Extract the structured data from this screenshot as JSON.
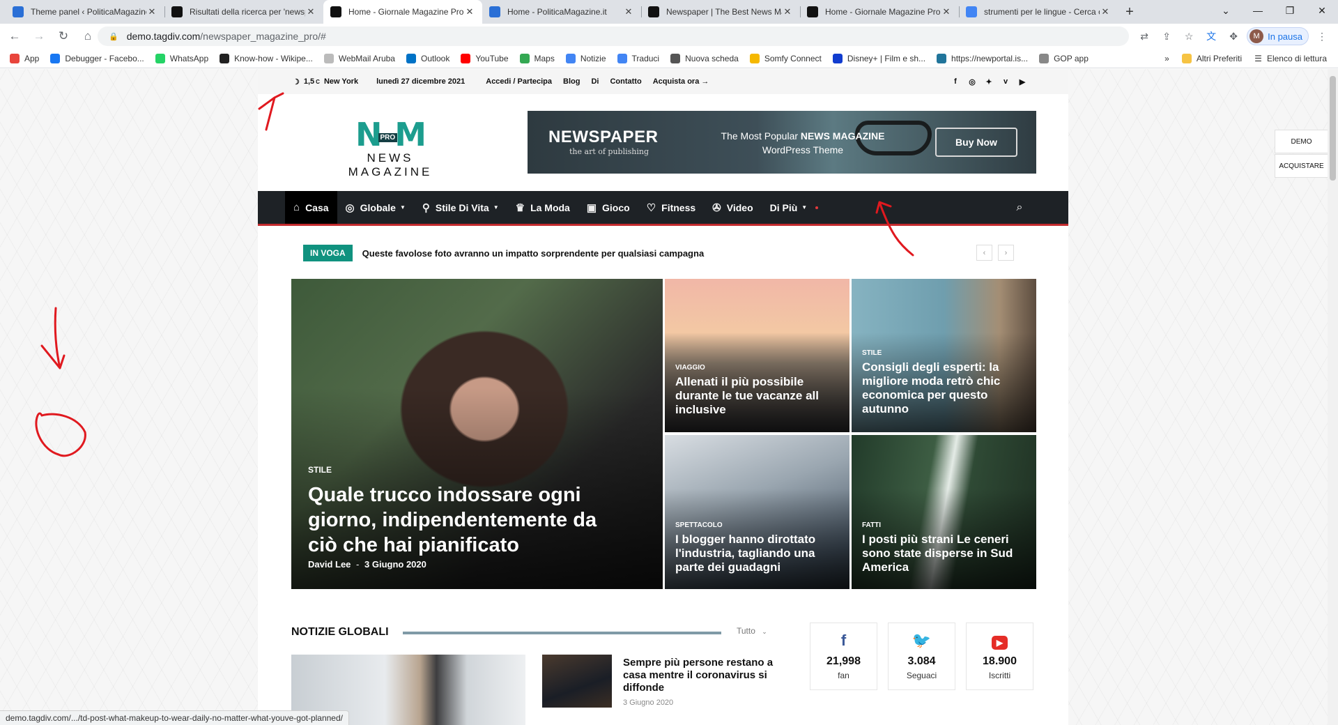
{
  "browser": {
    "tabs": [
      {
        "title": "Theme panel ‹ PoliticaMagazine",
        "favicon_color": "#2a6fd6",
        "active": false
      },
      {
        "title": "Risultati della ricerca per 'newsp",
        "favicon_color": "#111111",
        "active": false
      },
      {
        "title": "Home - Giornale Magazine Pro",
        "favicon_color": "#111111",
        "active": true
      },
      {
        "title": "Home - PoliticaMagazine.it",
        "favicon_color": "#2a6fd6",
        "active": false
      },
      {
        "title": "Newspaper | The Best News Ma",
        "favicon_color": "#111111",
        "active": false
      },
      {
        "title": "Home - Giornale Magazine Pro",
        "favicon_color": "#111111",
        "active": false
      },
      {
        "title": "strumenti per le lingue - Cerca c",
        "favicon_color": "#4285f4",
        "active": false
      }
    ],
    "url_host": "demo.tagdiv.com",
    "url_path": "/newspaper_magazine_pro/#",
    "profile_initial": "M",
    "profile_label": "In pausa",
    "bookmarks": [
      {
        "label": "App",
        "color": "#e8453c"
      },
      {
        "label": "Debugger - Facebo...",
        "color": "#1877f2"
      },
      {
        "label": "WhatsApp",
        "color": "#25d366"
      },
      {
        "label": "Know-how - Wikipe...",
        "color": "#222222"
      },
      {
        "label": "WebMail Aruba",
        "color": "#bbbbbb"
      },
      {
        "label": "Outlook",
        "color": "#0072c6"
      },
      {
        "label": "YouTube",
        "color": "#ff0000"
      },
      {
        "label": "Maps",
        "color": "#34a853"
      },
      {
        "label": "Notizie",
        "color": "#4285f4"
      },
      {
        "label": "Traduci",
        "color": "#4285f4"
      },
      {
        "label": "Nuova scheda",
        "color": "#555555"
      },
      {
        "label": "Somfy Connect",
        "color": "#f5b800"
      },
      {
        "label": "Disney+ | Film e sh...",
        "color": "#113ccf"
      },
      {
        "label": "https://newportal.is...",
        "color": "#21759b"
      },
      {
        "label": "GOP app",
        "color": "#888888"
      }
    ],
    "bookmarks_more": "»",
    "other_bookmarks": "Altri Preferiti",
    "reading_list": "Elenco di lettura",
    "status_url": "demo.tagdiv.com/.../td-post-what-makeup-to-wear-daily-no-matter-what-youve-got-planned/"
  },
  "site": {
    "topbar": {
      "temperature": "1,5",
      "unit": "C",
      "city": "New York",
      "date": "lunedì 27 dicembre 2021",
      "links": [
        "Accedi / Partecipa",
        "Blog",
        "Di",
        "Contatto",
        "Acquista ora"
      ]
    },
    "logo": {
      "letters": "NM",
      "badge": "PRO",
      "subtitle": "NEWS MAGAZINE"
    },
    "banner": {
      "title": "NEWSPAPER",
      "subtitle": "the art of publishing",
      "text_pre": "The Most Popular ",
      "text_bold": "NEWS MAGAZINE",
      "text_post": "WordPress Theme",
      "button": "Buy Now"
    },
    "menu": [
      {
        "label": "Casa",
        "icon": "home-icon",
        "glyph": "⌂",
        "has_caret": false,
        "active": true
      },
      {
        "label": "Globale",
        "icon": "globe-icon",
        "glyph": "◎",
        "has_caret": true,
        "active": false
      },
      {
        "label": "Stile Di Vita",
        "icon": "bicycle-icon",
        "glyph": "⚲",
        "has_caret": true,
        "active": false
      },
      {
        "label": "La Moda",
        "icon": "fashion-icon",
        "glyph": "♛",
        "has_caret": false,
        "active": false
      },
      {
        "label": "Gioco",
        "icon": "gamepad-icon",
        "glyph": "▣",
        "has_caret": false,
        "active": false
      },
      {
        "label": "Fitness",
        "icon": "heart-icon",
        "glyph": "♡",
        "has_caret": false,
        "active": false
      },
      {
        "label": "Video",
        "icon": "film-icon",
        "glyph": "✇",
        "has_caret": false,
        "active": false
      },
      {
        "label": "Di Più",
        "icon": "",
        "glyph": "",
        "has_caret": true,
        "active": false
      }
    ],
    "trending": {
      "tag": "IN VOGA",
      "headline": "Queste favolose foto avranno un impatto sorprendente per qualsiasi campagna"
    },
    "grid": {
      "main": {
        "category": "STILE",
        "title": "Quale trucco indossare ogni giorno, indipendentemente da ciò che hai pianificato",
        "author": "David Lee",
        "separator": "-",
        "date": "3 Giugno 2020"
      },
      "items": [
        {
          "category": "VIAGGIO",
          "title": "Allenati il più possibile durante le tue vacanze all inclusive"
        },
        {
          "category": "STILE",
          "title": "Consigli degli esperti: la migliore moda retrò chic economica per questo autunno"
        },
        {
          "category": "SPETTACOLO",
          "title": "I blogger hanno dirottato l'industria, tagliando una parte dei guadagni"
        },
        {
          "category": "FATTI",
          "title": "I posti più strani Le ceneri sono state disperse in Sud America"
        }
      ]
    },
    "section": {
      "title": "NOTIZIE GLOBALI",
      "filter": "Tutto",
      "article_title": "Sempre più persone restano a casa mentre il coronavirus si diffonde",
      "article_date": "3 Giugno 2020"
    },
    "social": [
      {
        "icon": "facebook-icon",
        "glyph": "f",
        "color": "#3b5998",
        "count": "21,998",
        "label": "fan"
      },
      {
        "icon": "twitter-icon",
        "glyph": "🐦",
        "color": "#1da1f2",
        "count": "3.084",
        "label": "Seguaci"
      },
      {
        "icon": "youtube-icon",
        "glyph": "▶",
        "color": "#e52d27",
        "count": "18.900",
        "label": "Iscritti"
      }
    ],
    "side_tabs": {
      "demo": "DEMO",
      "buy": "ACQUISTARE"
    }
  },
  "colors": {
    "accent_red": "#c32b2e",
    "accent_teal": "#10927f",
    "annotation": "#e0191f"
  }
}
